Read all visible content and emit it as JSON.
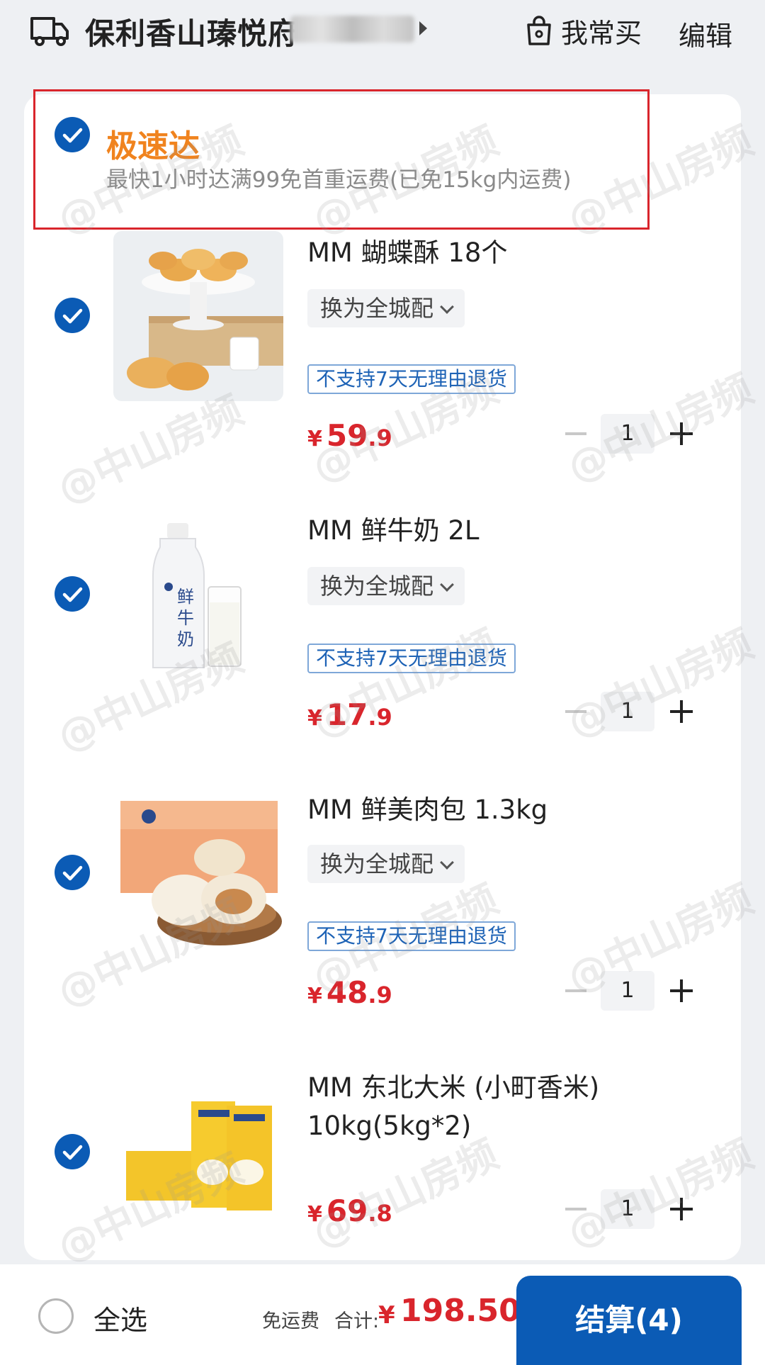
{
  "header": {
    "address": "保利香山瑧悦府",
    "frequent_label": "我常买",
    "edit_label": "编辑"
  },
  "store": {
    "name": "极速达",
    "subtitle": "最快1小时达满99免首重运费(已免15kg内运费)"
  },
  "items": [
    {
      "name": "MM 蝴蝶酥 18个",
      "switch_label": "换为全城配",
      "tag": "不支持7天无理由退货",
      "currency": "¥",
      "price_int": "59",
      "price_dec": ".9",
      "qty": "1"
    },
    {
      "name": "MM 鲜牛奶 2L",
      "switch_label": "换为全城配",
      "tag": "不支持7天无理由退货",
      "currency": "¥",
      "price_int": "17",
      "price_dec": ".9",
      "qty": "1"
    },
    {
      "name": "MM 鲜美肉包 1.3kg",
      "switch_label": "换为全城配",
      "tag": "不支持7天无理由退货",
      "currency": "¥",
      "price_int": "48",
      "price_dec": ".9",
      "qty": "1"
    },
    {
      "name": "MM 东北大米 (小町香米) 10kg(5kg*2)",
      "currency": "¥",
      "price_int": "69",
      "price_dec": ".8",
      "qty": "1"
    }
  ],
  "watermark": "@中山房频",
  "footer": {
    "select_all": "全选",
    "free_shipping": "免运费",
    "total_label": "合计:",
    "currency": "¥",
    "total": "198.50",
    "checkout_label": "结算(4)"
  },
  "colors": {
    "accent_blue": "#0b5bb5",
    "price_red": "#d9252c",
    "store_orange": "#f0831e"
  },
  "icons": {
    "delivery": "truck-icon",
    "frequent": "shopping-bag-icon",
    "checked": "check-circle-icon",
    "dropdown": "chevron-down-icon"
  }
}
